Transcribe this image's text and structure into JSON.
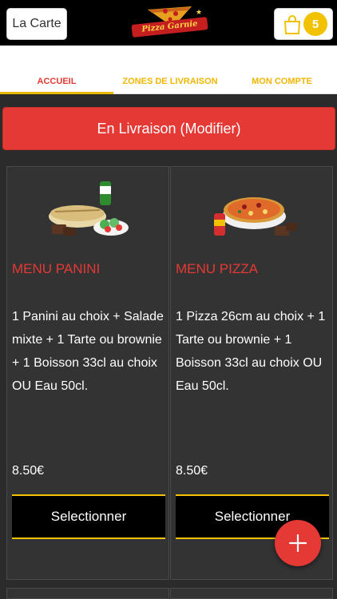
{
  "header": {
    "menu_label": "La Carte",
    "logo_text": "Pizza Garnie",
    "cart_count": "5"
  },
  "tabs": [
    {
      "label": "ACCUEIL",
      "active": true
    },
    {
      "label": "ZONES DE LIVRAISON",
      "active": false
    },
    {
      "label": "MON COMPTE",
      "active": false
    }
  ],
  "delivery_button": "En Livraison (Modifier)",
  "products": [
    {
      "title": "MENU PANINI",
      "description": "1 Panini au choix  + Salade mixte  + 1 Tarte ou brownie  + 1 Boisson 33cl au choix OU Eau 50cl.",
      "price": "8.50€",
      "button": "Selectionner",
      "image": "panini-menu-photo"
    },
    {
      "title": "MENU PIZZA",
      "description": "1 Pizza 26cm au choix  + 1 Tarte ou brownie  + 1 Boisson 33cl au choix OU Eau 50cl.",
      "price": "8.50€",
      "button": "Selectionner",
      "image": "pizza-menu-photo"
    }
  ],
  "fab": {
    "icon": "plus-icon"
  },
  "colors": {
    "accent_red": "#e53935",
    "accent_yellow": "#f2c200",
    "background_dark": "#2b2b2b"
  }
}
